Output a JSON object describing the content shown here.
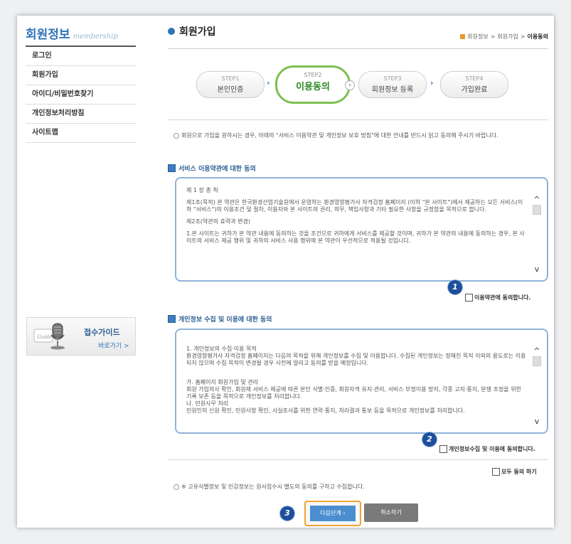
{
  "sidebar": {
    "title": "회원정보",
    "subtitle": "membership",
    "items": [
      {
        "label": "로그인"
      },
      {
        "label": "회원가입"
      },
      {
        "label": "아이디/비밀번호찾기"
      },
      {
        "label": "개인정보처리방침"
      },
      {
        "label": "사이트맵"
      }
    ],
    "guide": {
      "title": "접수가이드",
      "link": "바로가기 >",
      "icon_text": "Guide"
    }
  },
  "page": {
    "title": "회원가입",
    "breadcrumb": [
      "회원정보",
      "회원가입",
      "이용동의"
    ],
    "breadcrumb_sep": ">"
  },
  "steps": [
    {
      "num": "STEP1",
      "label": "본인인증"
    },
    {
      "num": "STEP2",
      "label": "이용동의"
    },
    {
      "num": "STEP3",
      "label": "회원정보 등록"
    },
    {
      "num": "STEP4",
      "label": "가입완료"
    }
  ],
  "intro": "회원으로 가입을 원하시는 경우, 아래의 \"서비스 이용약관 및 개인정보 보호 방침\"에 대한 안내를 반드시 읽고 동의해 주시기 바랍니다.",
  "terms": {
    "heading": "서비스 이용약관에 대한 동의",
    "paragraphs": [
      "제 1 장 총 칙",
      "제1조(목적) 본 약관은 한국환경산업기술원에서 운영하는 환경영향평가사 자격검정 홈페이지 (이하 \"본 사이트\")에서 제공하는 모든 서비스(이하 \"서비스\")의 이용조건 및 절차, 이용자와 본 사이트의 권리, 의무, 책임사항과 기타 필요한 사항을 규정함을 목적으로 합니다.",
      "제2조(약관의 효력과 변경)",
      "1.본 사이트는 귀하가 본 약관 내용에 동의하는 것을 조건으로 귀하에게 서비스를 제공할 것이며, 귀하가 본 약관의 내용에 동의하는 경우, 본 사이트의 서비스 제공 행위 및 귀하의 서비스 사용 행위에 본 약관이 우선적으로 적용될 것입니다."
    ],
    "agree_label": "이용약관에 동의합니다.",
    "marker": "1"
  },
  "privacy": {
    "heading": "개인정보 수집 및 이용에 대한 동의",
    "paragraphs": [
      "1. 개인정보의 수집·이용 목적\n환경영향평가사 자격검정 홈페이지는 다음의 목적을 위해 개인정보를 수집 및 이용합니다. 수집된 개인정보는 정해진 목적 이외의 용도로는 이용되지 않으며 수집 목적이 변경될 경우 사전에 알리고 동의를 받을 예정입니다.",
      "가. 홈페이지 회원가입 및 관리\n회원 가입의사 확인, 회원제 서비스 제공에 따른 본인 식별·인증, 회원자격 유지·관리, 서비스 부정이용 방지, 각종 고지·통지, 분쟁 조정을 위한 기록 보존 등을 목적으로 개인정보를 처리합니다.\n나. 민원사무 처리\n민원인의 신원 확인, 민원사항 확인, 사실조사를 위한 연락·통지, 처리결과 통보 등을 목적으로 개인정보를 처리합니다."
    ],
    "agree_label": "개인정보수집 및 이용에 동의합니다.",
    "marker": "2"
  },
  "agree_all_label": "모두 동의 하기",
  "note": "※ 고유식별정보 및 민감정보는 원서접수시 별도의 동의를 구하고 수집합니다.",
  "buttons": {
    "next": "다음단계 ›",
    "cancel": "취소하기",
    "marker": "3"
  },
  "colors": {
    "accent": "#2e74b8",
    "active_step": "#7cc04f",
    "highlight": "#f0a334",
    "marker": "#1d4f9c"
  }
}
